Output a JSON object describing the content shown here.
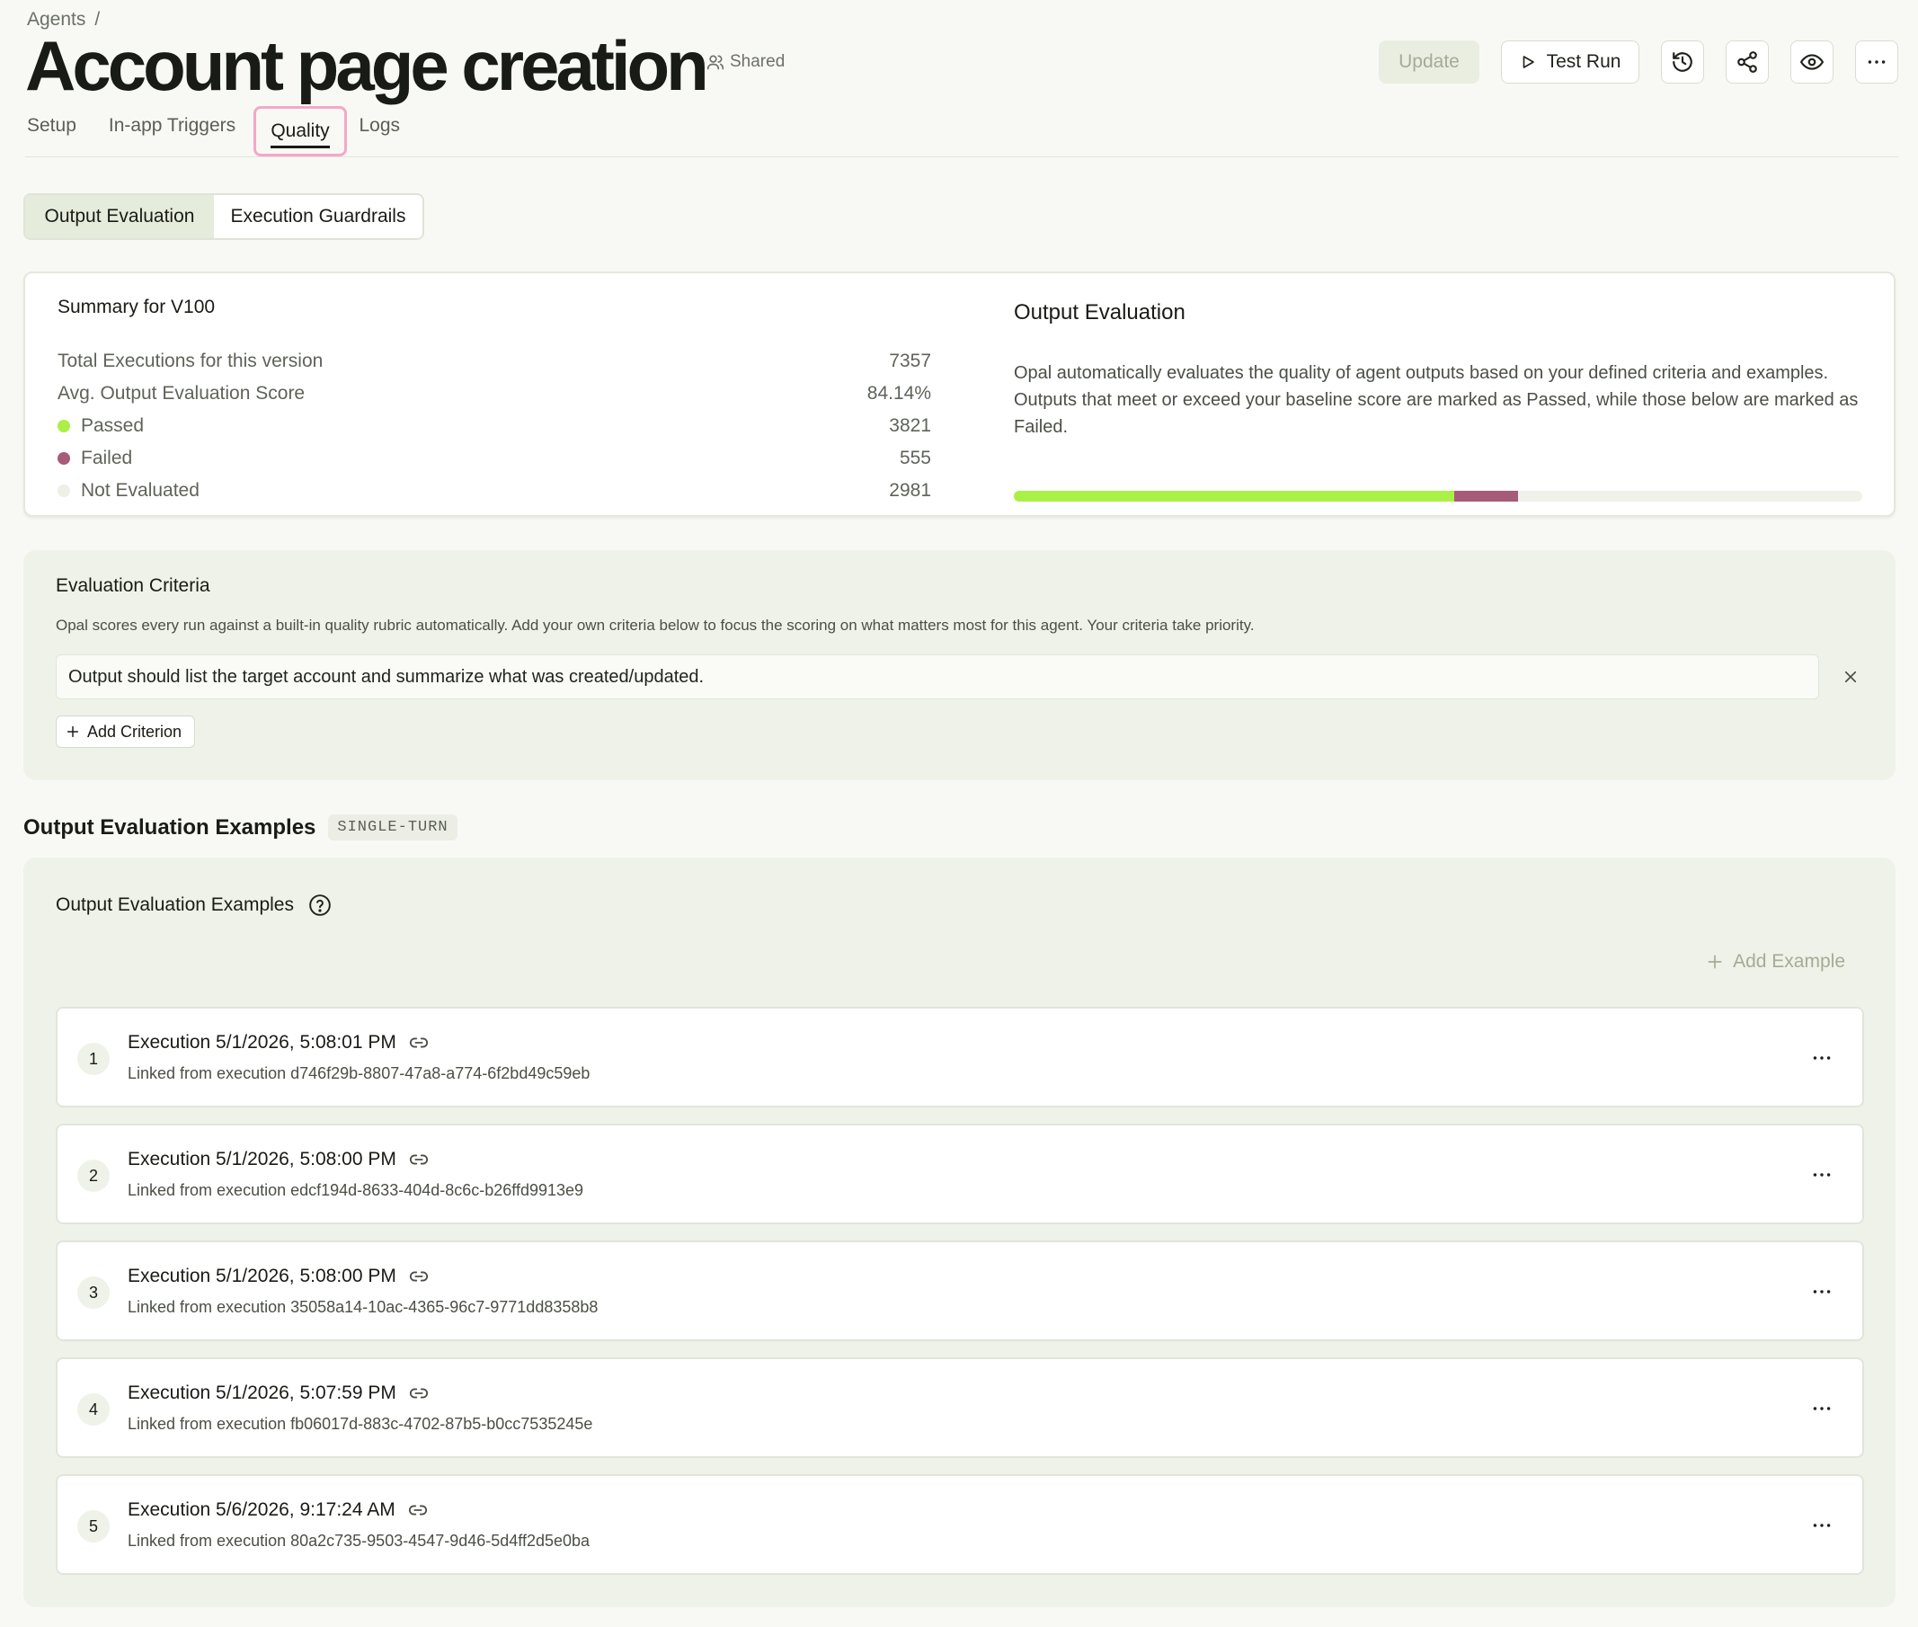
{
  "breadcrumb": {
    "parent": "Agents",
    "separator": "/"
  },
  "title": "Account page creation",
  "shared_label": "Shared",
  "actions": {
    "update_label": "Update",
    "test_run_label": "Test Run",
    "icons": [
      "history-icon",
      "share-icon",
      "eye-icon",
      "more-icon"
    ]
  },
  "tabs": [
    {
      "label": "Setup"
    },
    {
      "label": "In-app Triggers"
    },
    {
      "label": "Quality",
      "active": true
    },
    {
      "label": "Logs"
    }
  ],
  "segmented": {
    "active": "Output Evaluation",
    "inactive": "Execution Guardrails"
  },
  "summary": {
    "title": "Summary for V100",
    "rows": [
      {
        "label": "Total Executions for this version",
        "value": "7357"
      },
      {
        "label": "Avg. Output Evaluation Score",
        "value": "84.14%"
      },
      {
        "label": "Passed",
        "value": "3821",
        "dot_color": "#aaf046"
      },
      {
        "label": "Failed",
        "value": "555",
        "dot_color": "#a85a79"
      },
      {
        "label": "Not Evaluated",
        "value": "2981",
        "dot_color": "#eef0e8"
      }
    ],
    "panel_title": "Output Evaluation",
    "panel_description": "Opal automatically evaluates the quality of agent outputs based on your defined criteria and examples. Outputs that meet or exceed your baseline score are marked as Passed, while those below are marked as Failed.",
    "progress": {
      "passed": 3821,
      "failed": 555,
      "not_evaluated": 2981,
      "passed_color": "#aaf046",
      "failed_color": "#a85a79"
    }
  },
  "criteria": {
    "title": "Evaluation Criteria",
    "description": "Opal scores every run against a built-in quality rubric automatically. Add your own criteria below to focus the scoring on what matters most for this agent. Your criteria take priority.",
    "items": [
      "Output should list the target account and summarize what was created/updated."
    ],
    "add_label": "Add Criterion"
  },
  "examples": {
    "heading": "Output Evaluation Examples",
    "chip": "SINGLE-TURN",
    "panel_title": "Output Evaluation Examples",
    "add_label": "Add Example",
    "items": [
      {
        "num": "1",
        "title": "Execution 5/1/2026, 5:08:01 PM",
        "subtitle": "Linked from execution d746f29b-8807-47a8-a774-6f2bd49c59eb"
      },
      {
        "num": "2",
        "title": "Execution 5/1/2026, 5:08:00 PM",
        "subtitle": "Linked from execution edcf194d-8633-404d-8c6c-b26ffd9913e9"
      },
      {
        "num": "3",
        "title": "Execution 5/1/2026, 5:08:00 PM",
        "subtitle": "Linked from execution 35058a14-10ac-4365-96c7-9771dd8358b8"
      },
      {
        "num": "4",
        "title": "Execution 5/1/2026, 5:07:59 PM",
        "subtitle": "Linked from execution fb06017d-883c-4702-87b5-b0cc7535245e"
      },
      {
        "num": "5",
        "title": "Execution 5/6/2026, 9:17:24 AM",
        "subtitle": "Linked from execution 80a2c735-9503-4547-9d46-5d4ff2d5e0ba"
      }
    ]
  }
}
